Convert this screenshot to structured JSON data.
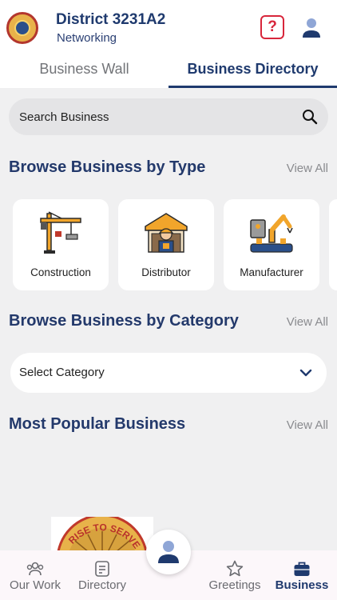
{
  "header": {
    "title": "District 3231A2",
    "subtitle": "Networking",
    "help_icon": "?"
  },
  "tabs": [
    {
      "label": "Business Wall",
      "active": false
    },
    {
      "label": "Business Directory",
      "active": true
    }
  ],
  "search": {
    "placeholder": "Search Business"
  },
  "sections": {
    "type": {
      "title": "Browse Business by Type",
      "view_all": "View All"
    },
    "category": {
      "title": "Browse Business by Category",
      "view_all": "View All"
    },
    "popular": {
      "title": "Most Popular Business",
      "view_all": "View All"
    }
  },
  "business_types": [
    {
      "label": "Construction",
      "icon": "crane-icon"
    },
    {
      "label": "Distributor",
      "icon": "warehouse-worker-icon"
    },
    {
      "label": "Manufacturer",
      "icon": "robot-arm-icon"
    }
  ],
  "category_select": {
    "selected": "Select Category"
  },
  "bottom_nav": [
    {
      "label": "Our Work",
      "icon": "people-icon",
      "active": false
    },
    {
      "label": "Directory",
      "icon": "directory-icon",
      "active": false
    },
    {
      "label": "Greetings",
      "icon": "star-icon",
      "active": false
    },
    {
      "label": "Business",
      "icon": "briefcase-icon",
      "active": true
    }
  ],
  "colors": {
    "primary": "#1f3a6e",
    "accent_red": "#d8263b",
    "background": "#f0f0f1",
    "card": "#ffffff"
  },
  "promo": {
    "text": "RISE TO SERVE"
  }
}
